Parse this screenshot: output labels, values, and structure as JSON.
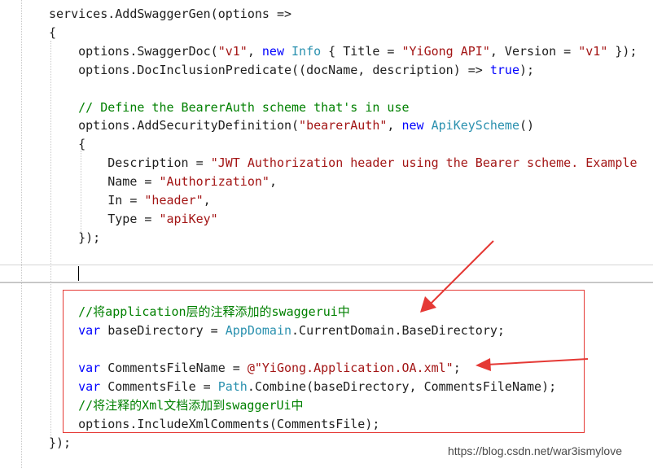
{
  "colors": {
    "plain": "#1e1e1e",
    "keyword": "#0000ff",
    "type": "#2b91af",
    "string": "#a31515",
    "comment": "#008000",
    "annotation": "#e53935"
  },
  "code_lines": [
    [
      {
        "c": "plain",
        "t": "services.AddSwaggerGen(options =>"
      }
    ],
    [
      {
        "c": "plain",
        "t": "{"
      }
    ],
    [
      {
        "c": "plain",
        "t": "    options.SwaggerDoc("
      },
      {
        "c": "str",
        "t": "\"v1\""
      },
      {
        "c": "plain",
        "t": ", "
      },
      {
        "c": "kw",
        "t": "new"
      },
      {
        "c": "plain",
        "t": " "
      },
      {
        "c": "type",
        "t": "Info"
      },
      {
        "c": "plain",
        "t": " { Title = "
      },
      {
        "c": "str",
        "t": "\"YiGong API\""
      },
      {
        "c": "plain",
        "t": ", Version = "
      },
      {
        "c": "str",
        "t": "\"v1\""
      },
      {
        "c": "plain",
        "t": " });"
      }
    ],
    [
      {
        "c": "plain",
        "t": "    options.DocInclusionPredicate((docName, description) => "
      },
      {
        "c": "kw",
        "t": "true"
      },
      {
        "c": "plain",
        "t": ");"
      }
    ],
    [],
    [
      {
        "c": "cmt",
        "t": "    // Define the BearerAuth scheme that's in use"
      }
    ],
    [
      {
        "c": "plain",
        "t": "    options.AddSecurityDefinition("
      },
      {
        "c": "str",
        "t": "\"bearerAuth\""
      },
      {
        "c": "plain",
        "t": ", "
      },
      {
        "c": "kw",
        "t": "new"
      },
      {
        "c": "plain",
        "t": " "
      },
      {
        "c": "type",
        "t": "ApiKeyScheme"
      },
      {
        "c": "plain",
        "t": "()"
      }
    ],
    [
      {
        "c": "plain",
        "t": "    {"
      }
    ],
    [
      {
        "c": "plain",
        "t": "        Description = "
      },
      {
        "c": "str",
        "t": "\"JWT Authorization header using the Bearer scheme. Example"
      }
    ],
    [
      {
        "c": "plain",
        "t": "        Name = "
      },
      {
        "c": "str",
        "t": "\"Authorization\""
      },
      {
        "c": "plain",
        "t": ","
      }
    ],
    [
      {
        "c": "plain",
        "t": "        In = "
      },
      {
        "c": "str",
        "t": "\"header\""
      },
      {
        "c": "plain",
        "t": ","
      }
    ],
    [
      {
        "c": "plain",
        "t": "        Type = "
      },
      {
        "c": "str",
        "t": "\"apiKey\""
      }
    ],
    [
      {
        "c": "plain",
        "t": "    });"
      }
    ],
    [],
    [],
    [],
    [
      {
        "c": "cmt",
        "t": "    //将application层的注释添加的swaggerui中"
      }
    ],
    [
      {
        "c": "kw",
        "t": "    var"
      },
      {
        "c": "plain",
        "t": " baseDirectory = "
      },
      {
        "c": "type",
        "t": "AppDomain"
      },
      {
        "c": "plain",
        "t": ".CurrentDomain.BaseDirectory;"
      }
    ],
    [],
    [
      {
        "c": "kw",
        "t": "    var"
      },
      {
        "c": "plain",
        "t": " CommentsFileName = "
      },
      {
        "c": "str",
        "t": "@\"YiGong.Application.OA.xml\""
      },
      {
        "c": "plain",
        "t": ";"
      }
    ],
    [
      {
        "c": "kw",
        "t": "    var"
      },
      {
        "c": "plain",
        "t": " CommentsFile = "
      },
      {
        "c": "type",
        "t": "Path"
      },
      {
        "c": "plain",
        "t": ".Combine(baseDirectory, CommentsFileName);"
      }
    ],
    [
      {
        "c": "cmt",
        "t": "    //将注释的Xml文档添加到swaggerUi中"
      }
    ],
    [
      {
        "c": "plain",
        "t": "    options.IncludeXmlComments(CommentsFile);"
      }
    ],
    [
      {
        "c": "plain",
        "t": "});"
      }
    ]
  ],
  "watermark": "https://blog.csdn.net/war3ismylove"
}
